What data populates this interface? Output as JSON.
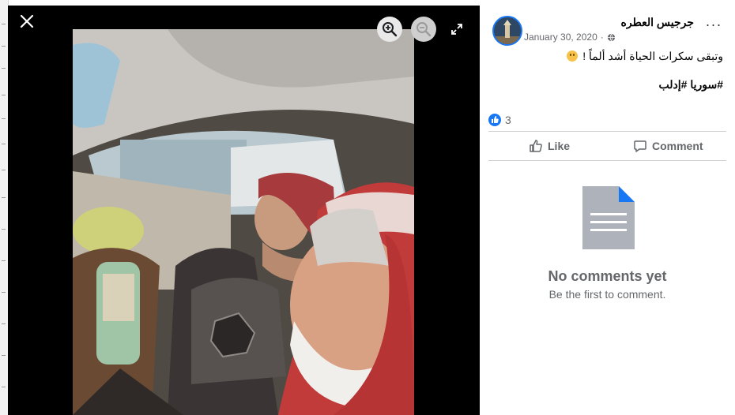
{
  "viewer": {
    "close_icon": "close-icon",
    "zoom_in_icon": "zoom-in-icon",
    "zoom_out_icon": "zoom-out-icon",
    "fullscreen_icon": "fullscreen-icon",
    "photo_subject": "photo"
  },
  "post": {
    "author": "جرجيس العطره",
    "date": "January 30, 2020",
    "audience_icon": "globe-icon",
    "text": "وتبقى سكرات الحياة أشد ألماً !",
    "emoji": "sad-face-emoji",
    "hashtags": "#سوريا #إدلب",
    "reaction_count": "3",
    "more_icon": "more-options-icon"
  },
  "actions": {
    "like_label": "Like",
    "comment_label": "Comment"
  },
  "comments": {
    "empty_title": "No comments yet",
    "empty_subtitle": "Be the first to comment."
  },
  "colors": {
    "accent": "#1877f2",
    "secondary_text": "#65676b",
    "viewer_bg": "#000000"
  }
}
